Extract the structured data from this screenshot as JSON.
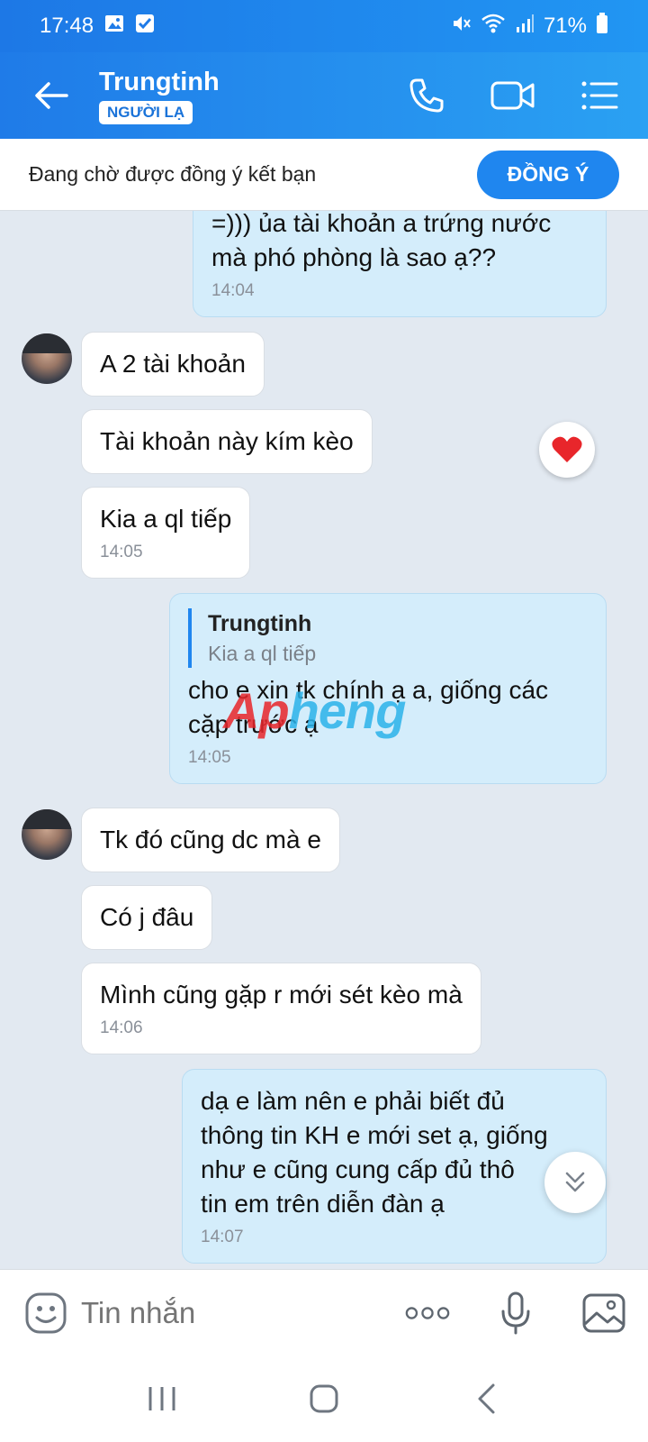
{
  "status_bar": {
    "time": "17:48",
    "battery": "71%"
  },
  "header": {
    "contact_name": "Trungtinh",
    "badge": "NGƯỜI LẠ"
  },
  "friend_request": {
    "text": "Đang chờ được đồng ý kết bạn",
    "accept_label": "ĐỒNG Ý"
  },
  "messages": [
    {
      "side": "out",
      "lines": [
        "=))) ủa tài khoản a trứng nước",
        "mà phó phòng là sao ạ??"
      ],
      "time": "14:04"
    },
    {
      "side": "in",
      "text": "A 2 tài khoản"
    },
    {
      "side": "in",
      "text": "Tài khoản này kím kèo",
      "reaction": "heart"
    },
    {
      "side": "in",
      "text": "Kia a ql tiếp",
      "time": "14:05"
    },
    {
      "side": "out",
      "quote_name": "Trungtinh",
      "quote_text": "Kia a ql tiếp",
      "lines": [
        "cho e xin tk chính ạ a, giống các",
        "cặp trước ạ"
      ],
      "time": "14:05"
    },
    {
      "side": "in",
      "text": "Tk đó cũng dc mà e"
    },
    {
      "side": "in",
      "text": "Có j đâu"
    },
    {
      "side": "in",
      "text": "Mình cũng gặp r mới sét kèo mà",
      "time": "14:06"
    },
    {
      "side": "out",
      "lines": [
        "dạ e làm nên e phải biết đủ",
        "thông tin KH e mới set ạ, giống",
        "như e cũng cung cấp đủ thô",
        "tin em trên diễn đàn ạ"
      ],
      "time": "14:07"
    }
  ],
  "watermark": {
    "part1": "Ap",
    "part2": "heng"
  },
  "input": {
    "placeholder": "Tin nhắn"
  },
  "icons": {
    "back": "arrow-left-icon",
    "call": "phone-icon",
    "video": "video-camera-icon",
    "menu": "list-menu-icon",
    "emoji": "emoji-icon",
    "more": "more-dots-icon",
    "mic": "microphone-icon",
    "image": "image-icon",
    "reaction": "heart-icon",
    "scroll": "double-chevron-down-icon"
  },
  "colors": {
    "header_blue": "#1f7be8",
    "accept_button": "#1f86ef",
    "outgoing_bubble": "#d4edfb",
    "incoming_bubble": "#ffffff",
    "chat_background": "#e2e9f1"
  }
}
